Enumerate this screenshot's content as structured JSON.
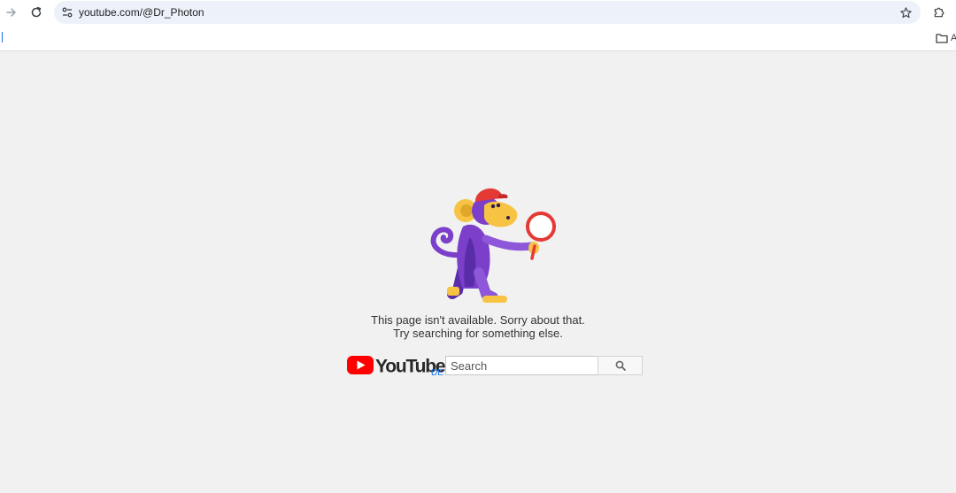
{
  "browser": {
    "url": "youtube.com/@Dr_Photon",
    "bookmarks_folder_label": "A"
  },
  "icons": {
    "forward": "arrow-right-icon",
    "reload": "reload-icon",
    "site_info": "tune-icon",
    "bookmark": "star-icon",
    "extensions": "puzzle-icon",
    "folder": "folder-icon",
    "search": "magnifier-icon"
  },
  "error": {
    "line1": "This page isn't available. Sorry about that.",
    "line2": "Try searching for something else."
  },
  "youtube": {
    "logo_text": "YouTube",
    "region": "DE",
    "search_placeholder": "Search"
  },
  "colors": {
    "brand_red": "#ff0000",
    "background": "#f1f1f1",
    "link_blue": "#1a73e8"
  }
}
